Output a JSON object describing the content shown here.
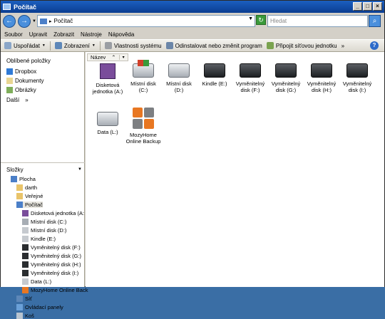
{
  "window": {
    "title": "Počítač"
  },
  "address": {
    "path": "Počítač",
    "search_placeholder": "Hledat"
  },
  "menu": [
    "Soubor",
    "Upravit",
    "Zobrazit",
    "Nástroje",
    "Nápověda"
  ],
  "toolbar": {
    "organize": "Uspořádat",
    "views": "Zobrazení",
    "system_properties": "Vlastnosti systému",
    "uninstall": "Odinstalovat nebo změnit program",
    "map_drive": "Připojit síťovou jednotku",
    "more": "»"
  },
  "favorites": {
    "header": "Oblíbené položky",
    "items": [
      "Dropbox",
      "Dokumenty",
      "Obrázky"
    ],
    "more": "Další",
    "more_chevron": "»"
  },
  "folders": {
    "header": "Složky",
    "tree": [
      {
        "label": "Plocha",
        "indent": 0
      },
      {
        "label": "darth",
        "indent": 1
      },
      {
        "label": "Veřejné",
        "indent": 1
      },
      {
        "label": "Počítač",
        "indent": 1
      },
      {
        "label": "Disketová jednotka (A:",
        "indent": 2
      },
      {
        "label": "Místní disk (C:)",
        "indent": 2
      },
      {
        "label": "Místní disk (D:)",
        "indent": 2
      },
      {
        "label": "Kindle (E:)",
        "indent": 2
      },
      {
        "label": "Vyměnitelný disk (F:)",
        "indent": 2
      },
      {
        "label": "Vyměnitelný disk (G:)",
        "indent": 2
      },
      {
        "label": "Vyměnitelný disk (H:)",
        "indent": 2
      },
      {
        "label": "Vyměnitelný disk (I:)",
        "indent": 2
      },
      {
        "label": "Data (L:)",
        "indent": 2
      },
      {
        "label": "MozyHome Online Back",
        "indent": 2
      },
      {
        "label": "Síť",
        "indent": 1
      },
      {
        "label": "Ovládací panely",
        "indent": 1
      },
      {
        "label": "Koš",
        "indent": 1
      }
    ]
  },
  "content": {
    "column_name": "Název",
    "drives": [
      {
        "label": "Disketová jednotka (A:)",
        "icon": "floppy-icon"
      },
      {
        "label": "Místní disk (C:)",
        "icon": "windows-drive-icon"
      },
      {
        "label": "Místní disk (D:)",
        "icon": "hard-drive-icon"
      },
      {
        "label": "Kindle (E:)",
        "icon": "removable-drive-icon"
      },
      {
        "label": "Vyměnitelný disk (F:)",
        "icon": "removable-drive-icon"
      },
      {
        "label": "Vyměnitelný disk (G:)",
        "icon": "removable-drive-icon"
      },
      {
        "label": "Vyměnitelný disk (H:)",
        "icon": "removable-drive-icon"
      },
      {
        "label": "Vyměnitelný disk (I:)",
        "icon": "removable-drive-icon"
      },
      {
        "label": "Data (L:)",
        "icon": "hard-drive-icon"
      },
      {
        "label": "MozyHome Online Backup",
        "icon": "mozy-icon"
      }
    ]
  }
}
